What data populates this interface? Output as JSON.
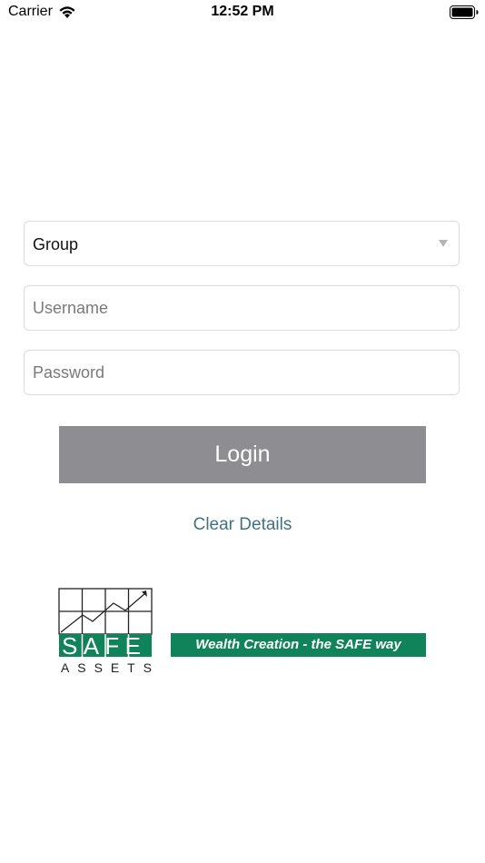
{
  "status_bar": {
    "carrier": "Carrier",
    "time": "12:52 PM"
  },
  "form": {
    "group": {
      "value": "Group",
      "icon": "chevron-down-icon"
    },
    "username": {
      "placeholder": "Username",
      "value": ""
    },
    "password": {
      "placeholder": "Password",
      "value": ""
    },
    "login_label": "Login",
    "clear_label": "Clear Details"
  },
  "branding": {
    "logo_word": "SAFE",
    "logo_subword": "ASSETS",
    "tagline": "Wealth Creation - the SAFE way",
    "brand_color": "#10835a"
  },
  "colors": {
    "button_bg": "#8e8e92",
    "link": "#3f7383",
    "field_border": "#dcdcdc"
  }
}
